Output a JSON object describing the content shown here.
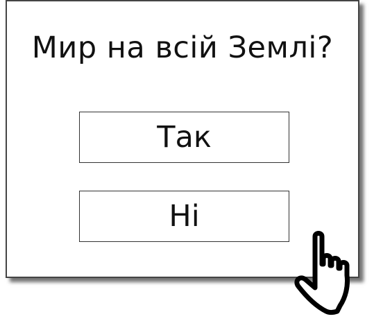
{
  "dialog": {
    "question": "Мир на всій Землі?",
    "yes_label": "Так",
    "no_label": "Ні"
  },
  "icons": {
    "cursor": "hand-pointer-icon"
  }
}
